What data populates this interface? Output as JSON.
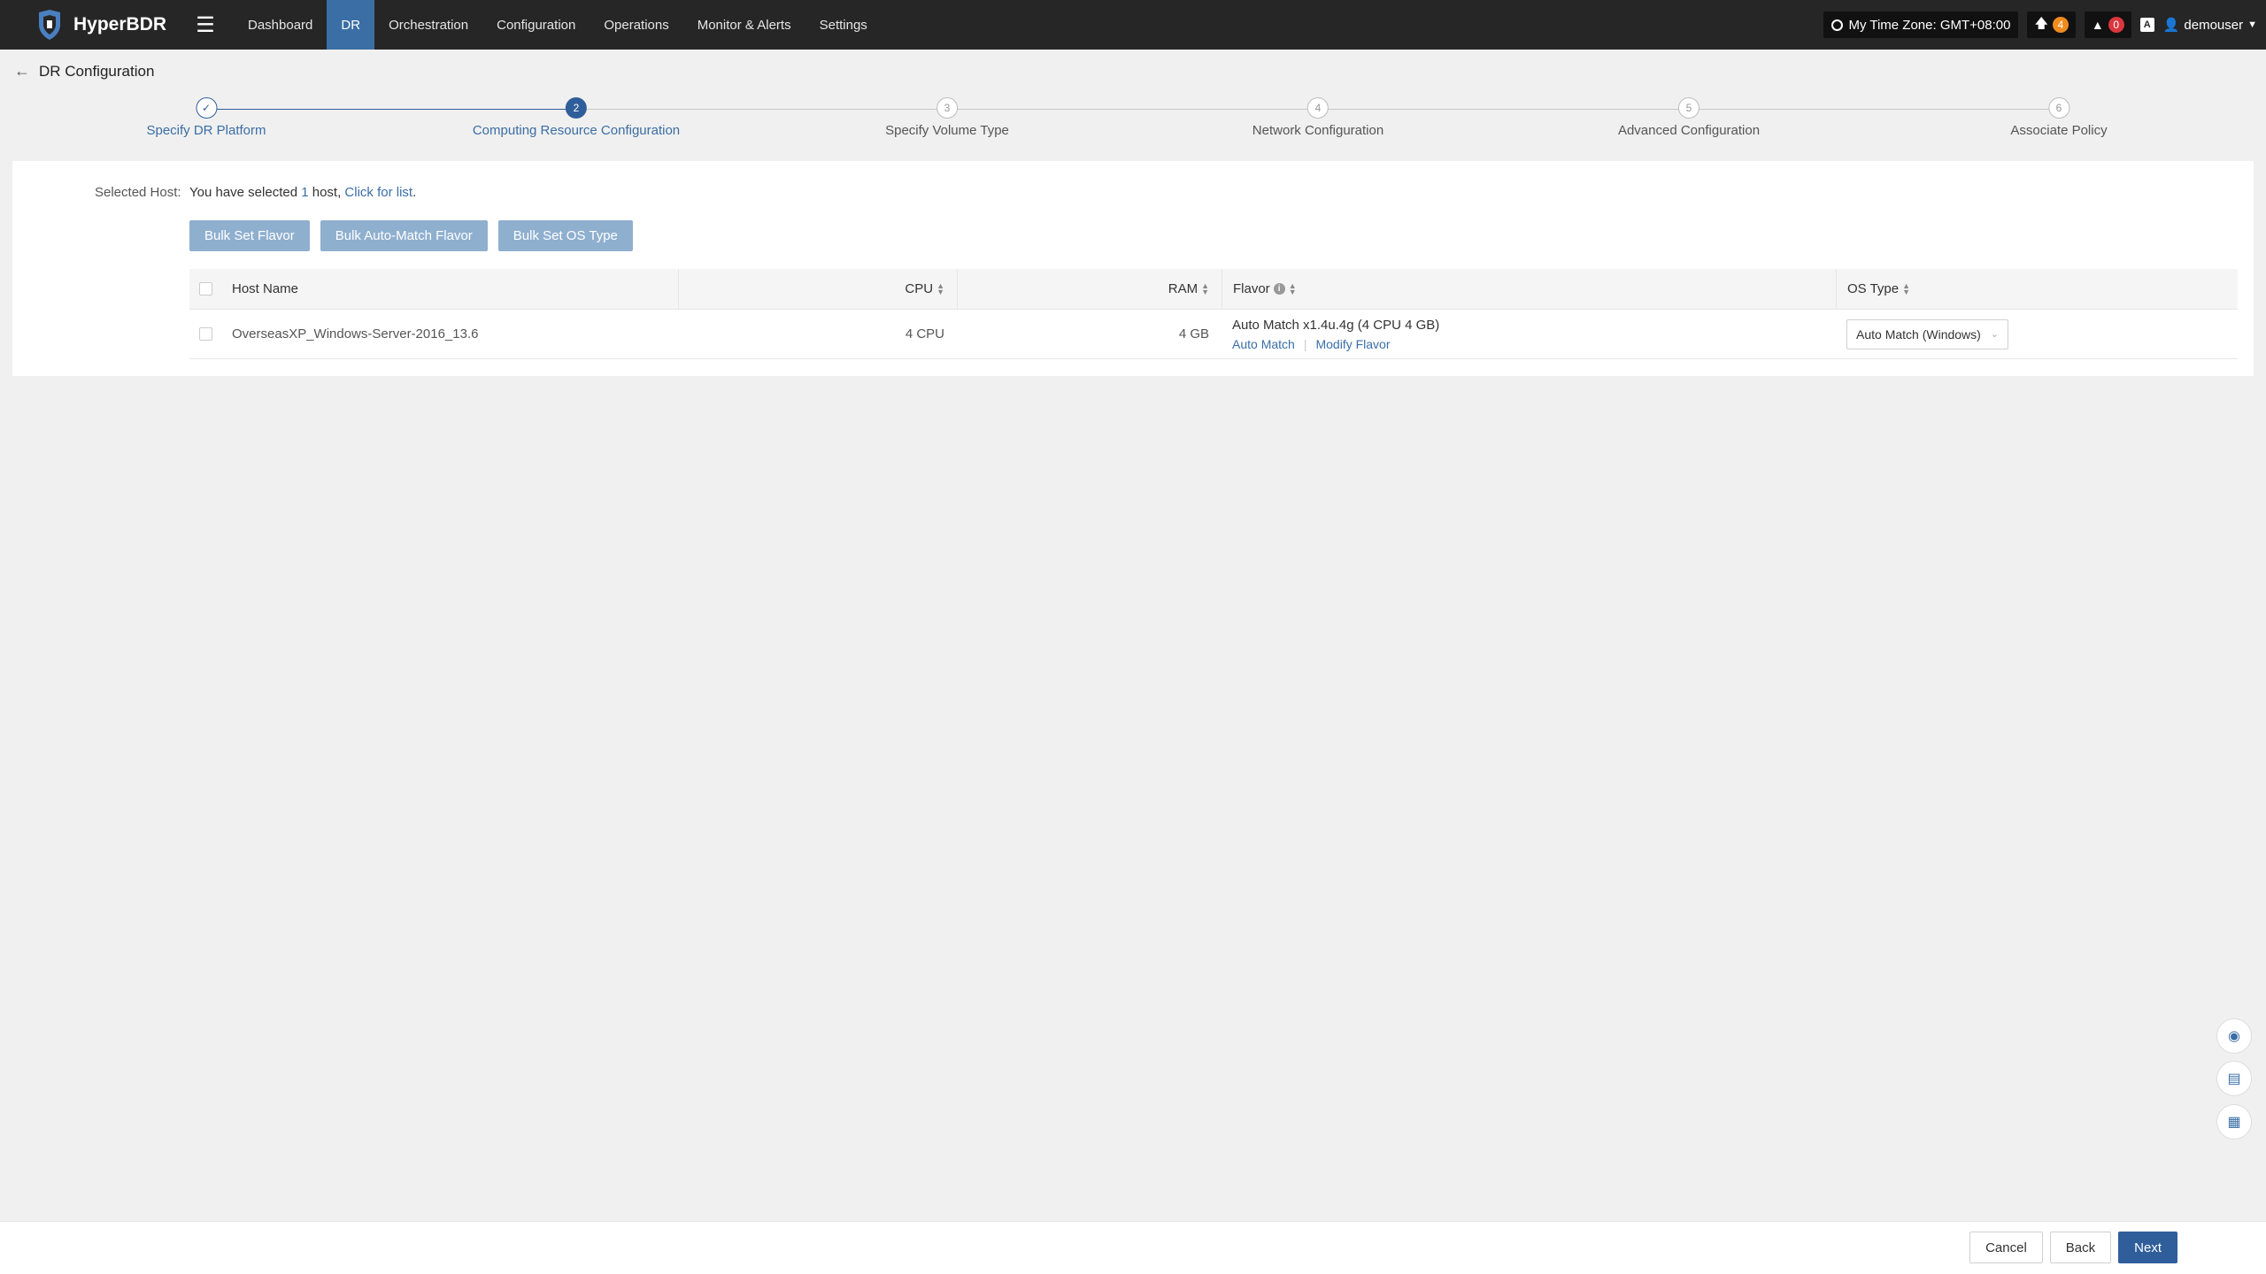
{
  "app": {
    "name": "HyperBDR"
  },
  "nav": {
    "items": [
      {
        "label": "Dashboard",
        "active": false
      },
      {
        "label": "DR",
        "active": true
      },
      {
        "label": "Orchestration",
        "active": false
      },
      {
        "label": "Configuration",
        "active": false
      },
      {
        "label": "Operations",
        "active": false
      },
      {
        "label": "Monitor & Alerts",
        "active": false
      },
      {
        "label": "Settings",
        "active": false
      }
    ]
  },
  "topbar": {
    "timezone": "My Time Zone: GMT+08:00",
    "upgrade_count": "4",
    "alert_count": "0",
    "username": "demouser"
  },
  "page": {
    "title": "DR Configuration"
  },
  "steps": [
    {
      "number": "1",
      "label": "Specify DR Platform",
      "state": "done"
    },
    {
      "number": "2",
      "label": "Computing Resource Configuration",
      "state": "active"
    },
    {
      "number": "3",
      "label": "Specify Volume Type",
      "state": "pending"
    },
    {
      "number": "4",
      "label": "Network Configuration",
      "state": "pending"
    },
    {
      "number": "5",
      "label": "Advanced Configuration",
      "state": "pending"
    },
    {
      "number": "6",
      "label": "Associate Policy",
      "state": "pending"
    }
  ],
  "selection": {
    "label": "Selected Host:",
    "prefix": "You have selected ",
    "count": "1",
    "suffix": " host, ",
    "link": "Click for list",
    "end": "."
  },
  "bulk_buttons": {
    "set_flavor": "Bulk Set Flavor",
    "auto_match": "Bulk Auto-Match Flavor",
    "set_os": "Bulk Set OS Type"
  },
  "table": {
    "headers": {
      "host": "Host Name",
      "cpu": "CPU",
      "ram": "RAM",
      "flavor": "Flavor",
      "os": "OS Type"
    },
    "rows": [
      {
        "host": "OverseasXP_Windows-Server-2016_13.6",
        "cpu": "4 CPU",
        "ram": "4 GB",
        "flavor": "Auto Match x1.4u.4g (4 CPU 4 GB)",
        "flavor_link_auto": "Auto Match",
        "flavor_link_modify": "Modify Flavor",
        "os": "Auto Match (Windows)"
      }
    ]
  },
  "footer": {
    "cancel": "Cancel",
    "back": "Back",
    "next": "Next"
  },
  "colors": {
    "topbar": "#262626",
    "accent": "#2f5e9b",
    "link": "#3a6ea5",
    "bulk_button": "#8fafcf"
  }
}
